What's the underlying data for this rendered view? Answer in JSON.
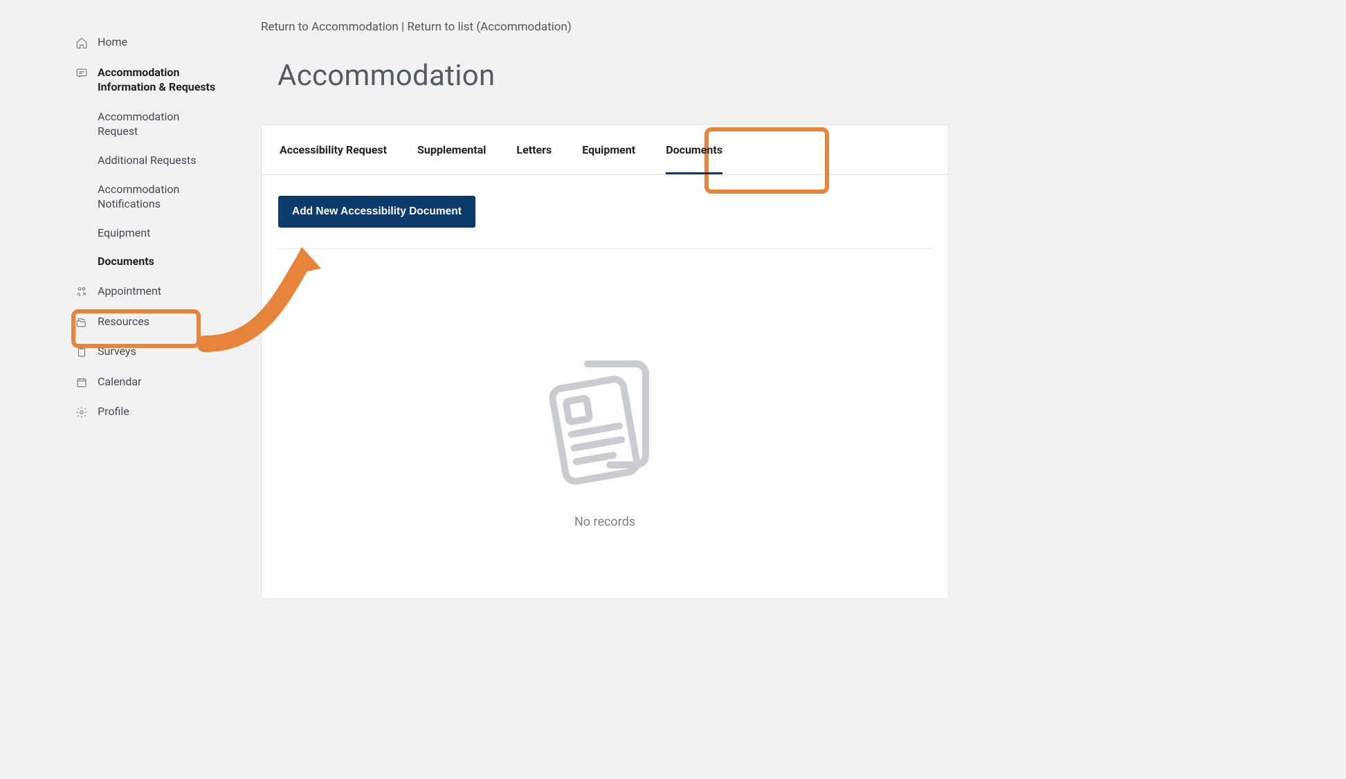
{
  "breadcrumb": {
    "return_link": "Return to Accommodation",
    "separator": " | ",
    "list_link": "Return to list (Accommodation)"
  },
  "page_title": "Accommodation",
  "sidebar": {
    "items": [
      {
        "label": "Home"
      },
      {
        "label": "Accommodation Information & Requests",
        "sub": [
          {
            "label": "Accommodation Request"
          },
          {
            "label": "Additional Requests"
          },
          {
            "label": "Accommodation Notifications"
          },
          {
            "label": "Equipment"
          },
          {
            "label": "Documents"
          }
        ]
      },
      {
        "label": "Appointment"
      },
      {
        "label": "Resources"
      },
      {
        "label": "Surveys"
      },
      {
        "label": "Calendar"
      },
      {
        "label": "Profile"
      }
    ]
  },
  "tabs": [
    {
      "label": "Accessibility Request"
    },
    {
      "label": "Supplemental"
    },
    {
      "label": "Letters"
    },
    {
      "label": "Equipment"
    },
    {
      "label": "Documents"
    }
  ],
  "buttons": {
    "add_document": "Add New Accessibility Document"
  },
  "empty_state": {
    "text": "No records"
  }
}
